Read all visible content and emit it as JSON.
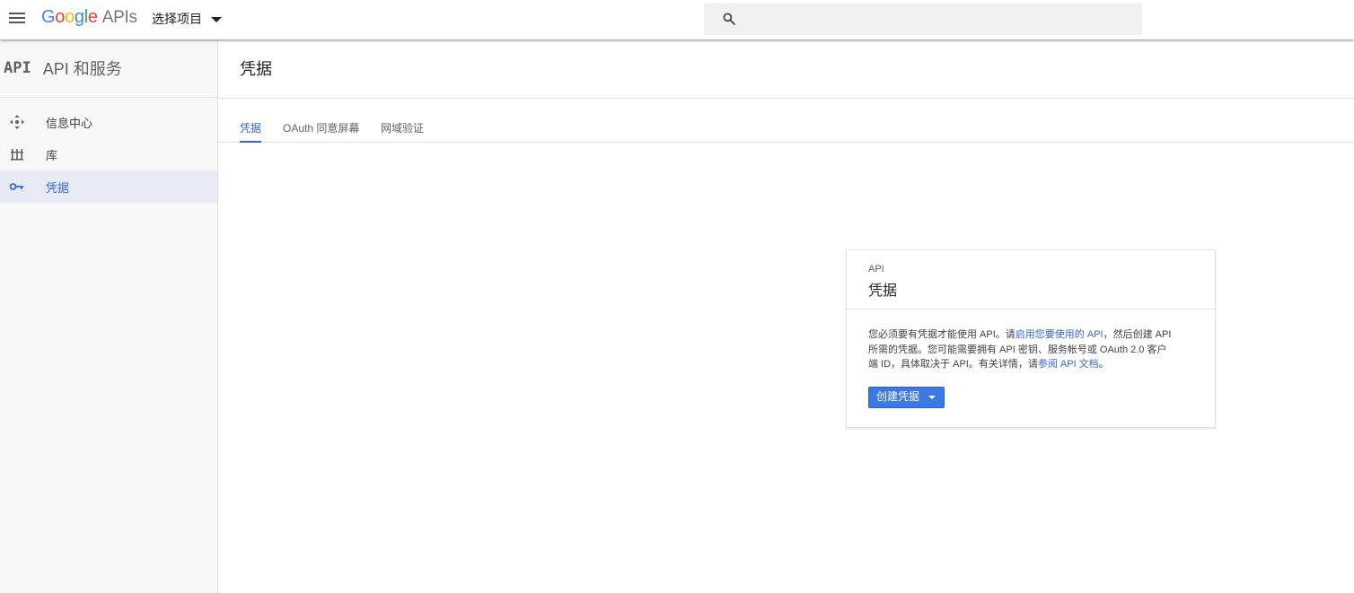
{
  "header": {
    "logo": {
      "g1": "G",
      "g2": "o",
      "g3": "o",
      "g4": "g",
      "g5": "l",
      "g6": "e",
      "apis": "APIs"
    },
    "project_label": "选择项目",
    "menu_icon": "hamburger-menu-icon",
    "search_icon": "search-icon"
  },
  "sidebar": {
    "badge": "API",
    "title": "API 和服务",
    "items": [
      {
        "label": "信息中心",
        "icon": "dashboard-icon"
      },
      {
        "label": "库",
        "icon": "library-icon"
      },
      {
        "label": "凭据",
        "icon": "key-icon"
      }
    ]
  },
  "main": {
    "title": "凭据",
    "tabs": [
      {
        "label": "凭据"
      },
      {
        "label": "OAuth 同意屏幕"
      },
      {
        "label": "网域验证"
      }
    ]
  },
  "card": {
    "kicker": "API",
    "title": "凭据",
    "text_1": "您必须要有凭据才能使用 API。请",
    "link_enable": "启用您要使用的 API",
    "text_2": "，然后创建 API 所需的凭据。您可能需要拥有 API 密钥、服务帐号或 OAuth 2.0 客户端 ID，具体取决于 API。有关详情，请",
    "link_docs": "参阅 API 文档",
    "text_3": "。",
    "create_button": "创建凭据"
  },
  "colors": {
    "accent": "#3367d6",
    "button": "#3b78e7",
    "sidebar_active_bg": "#e8eaf6"
  }
}
